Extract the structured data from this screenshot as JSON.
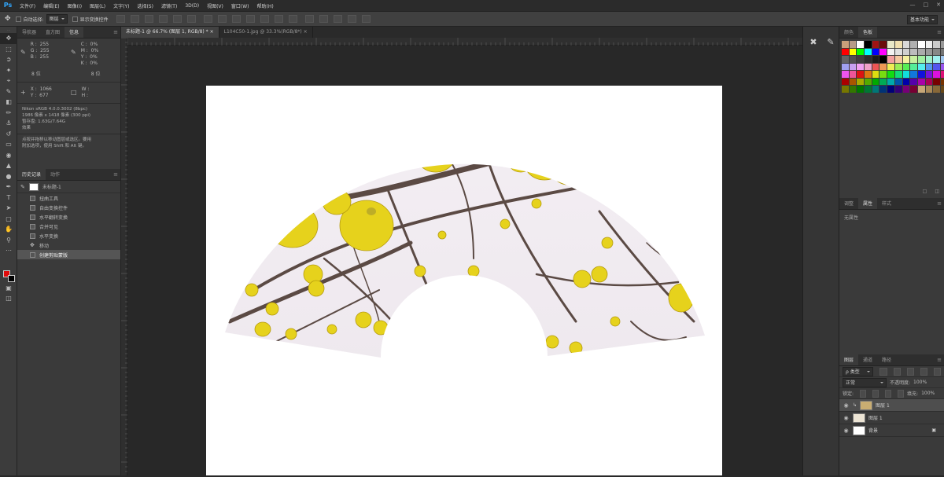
{
  "app": {
    "logo": "Ps"
  },
  "menu": [
    "文件(F)",
    "编辑(E)",
    "图像(I)",
    "图层(L)",
    "文字(Y)",
    "选择(S)",
    "滤镜(T)",
    "3D(D)",
    "视图(V)",
    "窗口(W)",
    "帮助(H)"
  ],
  "options": {
    "auto_select_label": "自动选择:",
    "auto_select_value": "图层",
    "show_transform": "显示变换控件",
    "workspace": "基本功能"
  },
  "doc_tabs": [
    "未标题-1 @ 66.7% (图层 1, RGB/8) *",
    "L104C50-1.jpg @ 33.3%(RGB/8*)"
  ],
  "left_panel": {
    "tabs": [
      "导航器",
      "直方图",
      "信息"
    ],
    "info": {
      "r": "R :",
      "g": "G :",
      "b": "B :",
      "rv": "255",
      "gv": "255",
      "bv": "255",
      "c": "C :",
      "m": "M :",
      "y": "Y :",
      "k": "K :",
      "cv": "0%",
      "mv": "0%",
      "yv": "0%",
      "kv": "0%",
      "bit1": "8 位",
      "bit2": "8 位",
      "x": "X :",
      "yl": "Y :",
      "xv": "1066",
      "yv2": "677",
      "w": "W :",
      "h": "H :",
      "doc_line1": "Nikon sRGB 4.0.0.3002 (8bpc)",
      "doc_line2": "1986 像素 x 1418 像素 (300 ppi)",
      "doc_line3": "暂存盘: 1.63G/7.64G",
      "doc_line4": "效果",
      "hint_line1": "点按并拖移以移动图层或选区。要用",
      "hint_line2": "附加选项，使用 Shift 和 Alt 键。"
    },
    "hist_tabs": [
      "历史记录",
      "动作"
    ],
    "snapshot": "未标题-1",
    "history": [
      "扭曲工具",
      "自由变换控件",
      "水平翻转变换",
      "合并可见",
      "水平变换",
      "移动",
      "创建剪贴蒙版"
    ]
  },
  "right_panel": {
    "color_tabs": [
      "颜色",
      "色板"
    ],
    "adj_tabs": [
      "调整",
      "属性",
      "样式"
    ],
    "no_props": "无属性",
    "layer_tabs": [
      "图层",
      "通道",
      "路径"
    ],
    "kind": "ρ 类型",
    "blend": "正常",
    "opacity_label": "不透明度:",
    "opacity": "100%",
    "lock_label": "锁定:",
    "fill_label": "填充:",
    "fill": "100%",
    "layers": [
      {
        "name": "图层 1",
        "thumb": "#c9ad72"
      },
      {
        "name": "图层 1",
        "thumb": "#ece4d4"
      },
      {
        "name": "背景",
        "thumb": "#ffffff"
      }
    ]
  },
  "swatches": [
    "#c9a07a",
    "#b79b86",
    "#ffffff",
    "#000000",
    "#a01414",
    "#6b0a0a",
    "#e8e8c8",
    "#f0e0b0",
    "#d8d8d8",
    "#b0b0b0",
    "#ffffff",
    "#eeeeee",
    "#cccccc",
    "#999999",
    "#ff0000",
    "#ffff00",
    "#00ff00",
    "#00ffff",
    "#0000ff",
    "#ff00ff",
    "#f2f2f2",
    "#e0e0e0",
    "#cfcfcf",
    "#bdbdbd",
    "#ababab",
    "#999999",
    "#878787",
    "#757575",
    "#636363",
    "#515151",
    "#3f3f3f",
    "#2d2d2d",
    "#1b1b1b",
    "#000000",
    "#f4a0a0",
    "#f4c8a0",
    "#f4f0a0",
    "#c8f0a0",
    "#a0f0a0",
    "#a0f0c8",
    "#a0f0f0",
    "#a0c8f0",
    "#a0a0f0",
    "#c8a0f0",
    "#f0a0f0",
    "#f0a0c8",
    "#ee5555",
    "#ee9955",
    "#eeee55",
    "#99ee55",
    "#55ee55",
    "#55ee99",
    "#55eeee",
    "#5599ee",
    "#5555ee",
    "#9955ee",
    "#ee55ee",
    "#ee5599",
    "#dd1111",
    "#dd7711",
    "#dddd11",
    "#77dd11",
    "#11dd11",
    "#11dd77",
    "#11dddd",
    "#1177dd",
    "#1111dd",
    "#7711dd",
    "#dd11dd",
    "#dd1177",
    "#aa0000",
    "#aa5500",
    "#aaaa00",
    "#55aa00",
    "#00aa00",
    "#00aa55",
    "#00aaaa",
    "#0055aa",
    "#0000aa",
    "#5500aa",
    "#aa00aa",
    "#aa0055",
    "#770000",
    "#773300",
    "#777700",
    "#337700",
    "#007700",
    "#007733",
    "#007777",
    "#003377",
    "#000077",
    "#330077",
    "#770077",
    "#770033",
    "#c8a878",
    "#a88858",
    "#886838",
    "#684818"
  ]
}
